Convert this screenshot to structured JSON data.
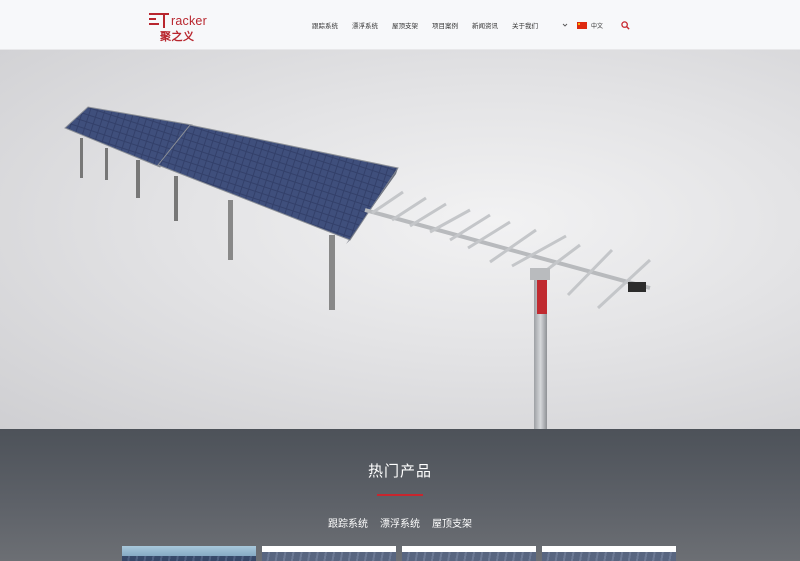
{
  "brand": {
    "logo_word": "racker",
    "logo_cn": "聚之义"
  },
  "nav": {
    "items": [
      {
        "label": "跟踪系统"
      },
      {
        "label": "漂浮系统"
      },
      {
        "label": "屋顶支架"
      },
      {
        "label": "项目案例"
      },
      {
        "label": "新闻资讯"
      },
      {
        "label": "关于我们"
      }
    ],
    "language": "中文"
  },
  "hero": {
    "slide_count": 4,
    "active_slide": 2
  },
  "products": {
    "title": "热门产品",
    "tabs": [
      {
        "label": "跟踪系统"
      },
      {
        "label": "漂浮系统"
      },
      {
        "label": "屋顶支架"
      }
    ]
  },
  "colors": {
    "accent": "#c7262e",
    "header_bg": "#f7f8fa",
    "section_bg": "#55595f"
  },
  "icons": {
    "search": "search-icon",
    "dropdown": "chevron-down-icon",
    "flag": "china-flag-icon"
  }
}
